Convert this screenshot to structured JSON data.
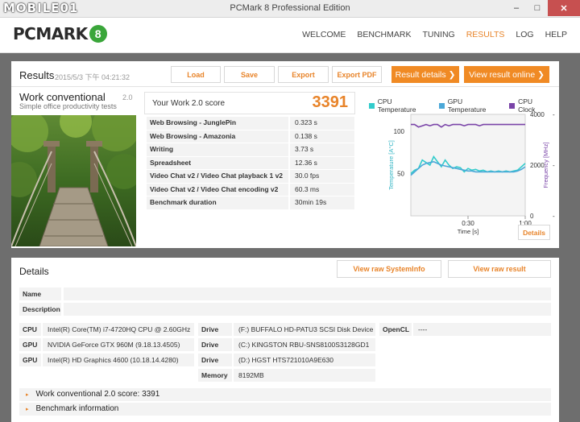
{
  "watermark": "MOBILE01",
  "window": {
    "title": "PCMark 8 Professional Edition",
    "minimize": "–",
    "maximize": "□",
    "close": "✕"
  },
  "brand": {
    "name": "PCMARK",
    "badge": "8",
    "badge_color": "#3aa63a"
  },
  "nav": {
    "items": [
      "WELCOME",
      "BENCHMARK",
      "TUNING",
      "RESULTS",
      "LOG",
      "HELP"
    ],
    "active": "RESULTS"
  },
  "colors": {
    "accent": "#e8842a",
    "cpu_temp": "#33cccc",
    "gpu_temp": "#4ba8d8",
    "cpu_clock": "#7a44a8"
  },
  "results": {
    "title": "Results",
    "date": "2015/5/3 下午 04:21:32",
    "buttons": {
      "load": "Load",
      "save": "Save",
      "export": "Export",
      "export_pdf": "Export PDF"
    },
    "orange_buttons": {
      "result_details": "Result details",
      "result_online": "View result online",
      "chevron": "❯"
    },
    "benchmark": {
      "name": "Work conventional",
      "version": "2.0",
      "description": "Simple office productivity tests"
    },
    "score": {
      "label": "Your Work 2.0 score",
      "value": "3391"
    },
    "subscores": [
      {
        "name": "Web Browsing - JunglePin",
        "value": "0.323 s"
      },
      {
        "name": "Web Browsing - Amazonia",
        "value": "0.138 s"
      },
      {
        "name": "Writing",
        "value": "3.73 s"
      },
      {
        "name": "Spreadsheet",
        "value": "12.36 s"
      },
      {
        "name": "Video Chat v2 / Video Chat playback 1 v2",
        "value": "30.0 fps"
      },
      {
        "name": "Video Chat v2 / Video Chat encoding v2",
        "value": "60.3 ms"
      },
      {
        "name": "Benchmark duration",
        "value": "30min 19s"
      }
    ],
    "details_button": "Details"
  },
  "chart_data": {
    "type": "line",
    "legend": [
      "CPU Temperature",
      "GPU Temperature",
      "CPU Clock"
    ],
    "legend_placement": "top",
    "ylabel_left": "Temperature [A°C]",
    "ylabel_right": "Frequency [MHz]",
    "xlabel": "Time [s]",
    "x_ticks": [
      "0:30",
      "1:00"
    ],
    "y_left_ticks": [
      "100",
      "50"
    ],
    "y_right_ticks": [
      "4000",
      "2000",
      "0"
    ],
    "xlim": [
      0,
      60
    ],
    "ylim_left": [
      0,
      120
    ],
    "ylim_right": [
      0,
      4000
    ],
    "grid": false,
    "series": [
      {
        "name": "CPU Clock",
        "axis": "right",
        "x": [
          0,
          2,
          4,
          6,
          8,
          10,
          12,
          14,
          16,
          18,
          20,
          22,
          24,
          26,
          28,
          30,
          32,
          34,
          36,
          38,
          40,
          42,
          44,
          46,
          48,
          50,
          52,
          54,
          56,
          58,
          60
        ],
        "values": [
          3600,
          3600,
          3500,
          3550,
          3600,
          3550,
          3600,
          3600,
          3500,
          3600,
          3550,
          3600,
          3600,
          3600,
          3550,
          3600,
          3600,
          3600,
          3550,
          3600,
          3600,
          3600,
          3600,
          3600,
          3600,
          3600,
          3600,
          3600,
          3600,
          3600,
          3600
        ]
      },
      {
        "name": "CPU Temperature",
        "axis": "left",
        "x": [
          0,
          2,
          4,
          6,
          8,
          10,
          12,
          14,
          16,
          18,
          20,
          22,
          24,
          26,
          28,
          30,
          32,
          34,
          36,
          38,
          40,
          42,
          44,
          46,
          48,
          50,
          52,
          54,
          56,
          58,
          60
        ],
        "values": [
          50,
          54,
          56,
          66,
          63,
          60,
          70,
          64,
          58,
          66,
          60,
          56,
          58,
          57,
          52,
          56,
          54,
          55,
          53,
          54,
          52,
          53,
          52,
          53,
          52,
          53,
          52,
          53,
          54,
          58,
          62
        ]
      },
      {
        "name": "GPU Temperature",
        "axis": "left",
        "x": [
          0,
          2,
          4,
          6,
          8,
          10,
          12,
          14,
          16,
          18,
          20,
          22,
          24,
          26,
          28,
          30,
          32,
          34,
          36,
          38,
          40,
          42,
          44,
          46,
          48,
          50,
          52,
          54,
          56,
          58,
          60
        ],
        "values": [
          48,
          52,
          56,
          60,
          62,
          63,
          64,
          62,
          60,
          59,
          58,
          57,
          56,
          55,
          54,
          53,
          53,
          52,
          52,
          52,
          52,
          52,
          52,
          52,
          52,
          52,
          52,
          52,
          53,
          55,
          58
        ]
      }
    ]
  },
  "details": {
    "title": "Details",
    "view_sysinfo": "View raw SystemInfo",
    "view_result": "View raw result",
    "name_label": "Name",
    "name_value": "",
    "description_label": "Description",
    "description_value": "",
    "hw": [
      {
        "label": "CPU",
        "value": "Intel(R) Core(TM) i7-4720HQ CPU @ 2.60GHz"
      },
      {
        "label": "GPU",
        "value": "NVIDIA GeForce GTX 960M (9.18.13.4505)"
      },
      {
        "label": "GPU",
        "value": "Intel(R) HD Graphics 4600 (10.18.14.4280)"
      }
    ],
    "drives": [
      {
        "label": "Drive",
        "value": "(F:) BUFFALO HD-PATU3 SCSI Disk Device"
      },
      {
        "label": "Drive",
        "value": "(C:) KINGSTON RBU-SNS8100S3128GD1"
      },
      {
        "label": "Drive",
        "value": "(D:) HGST HTS721010A9E630"
      },
      {
        "label": "Memory",
        "value": "8192MB"
      }
    ],
    "opencl": {
      "label": "OpenCL",
      "value": "----"
    },
    "expanders": [
      {
        "arrow": "▸",
        "label": "Work conventional 2.0 score: 3391"
      },
      {
        "arrow": "▸",
        "label": "Benchmark information"
      }
    ]
  }
}
